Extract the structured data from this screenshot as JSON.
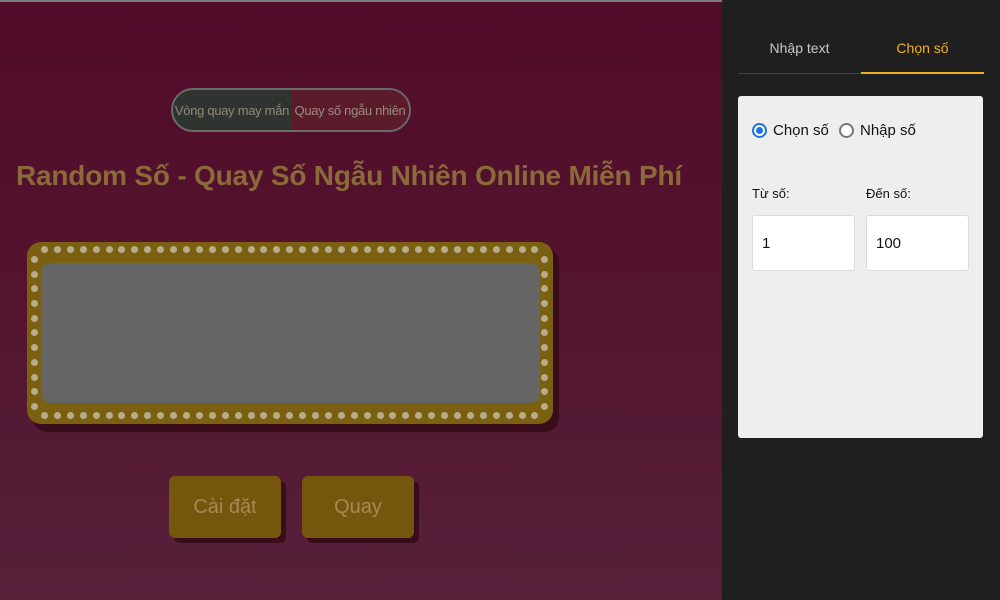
{
  "mode_switch": {
    "option_wheel": "Vòng quay may mắn",
    "option_random": "Quay số ngẫu nhiên"
  },
  "page_title": "Random Số - Quay Số Ngẫu Nhiên Online Miễn Phí",
  "buttons": {
    "settings": "Cài đặt",
    "spin": "Quay"
  },
  "sidebar": {
    "tabs": [
      "Nhập text",
      "Chọn số"
    ],
    "active_tab": "Chọn số",
    "radio_choose": "Chọn số",
    "radio_input": "Nhập số",
    "from_label": "Từ số:",
    "to_label": "Đến số:",
    "from_value": "1",
    "to_value": "100"
  },
  "colors": {
    "accent": "#f2b01e",
    "radio_checked": "#1a73e8"
  }
}
